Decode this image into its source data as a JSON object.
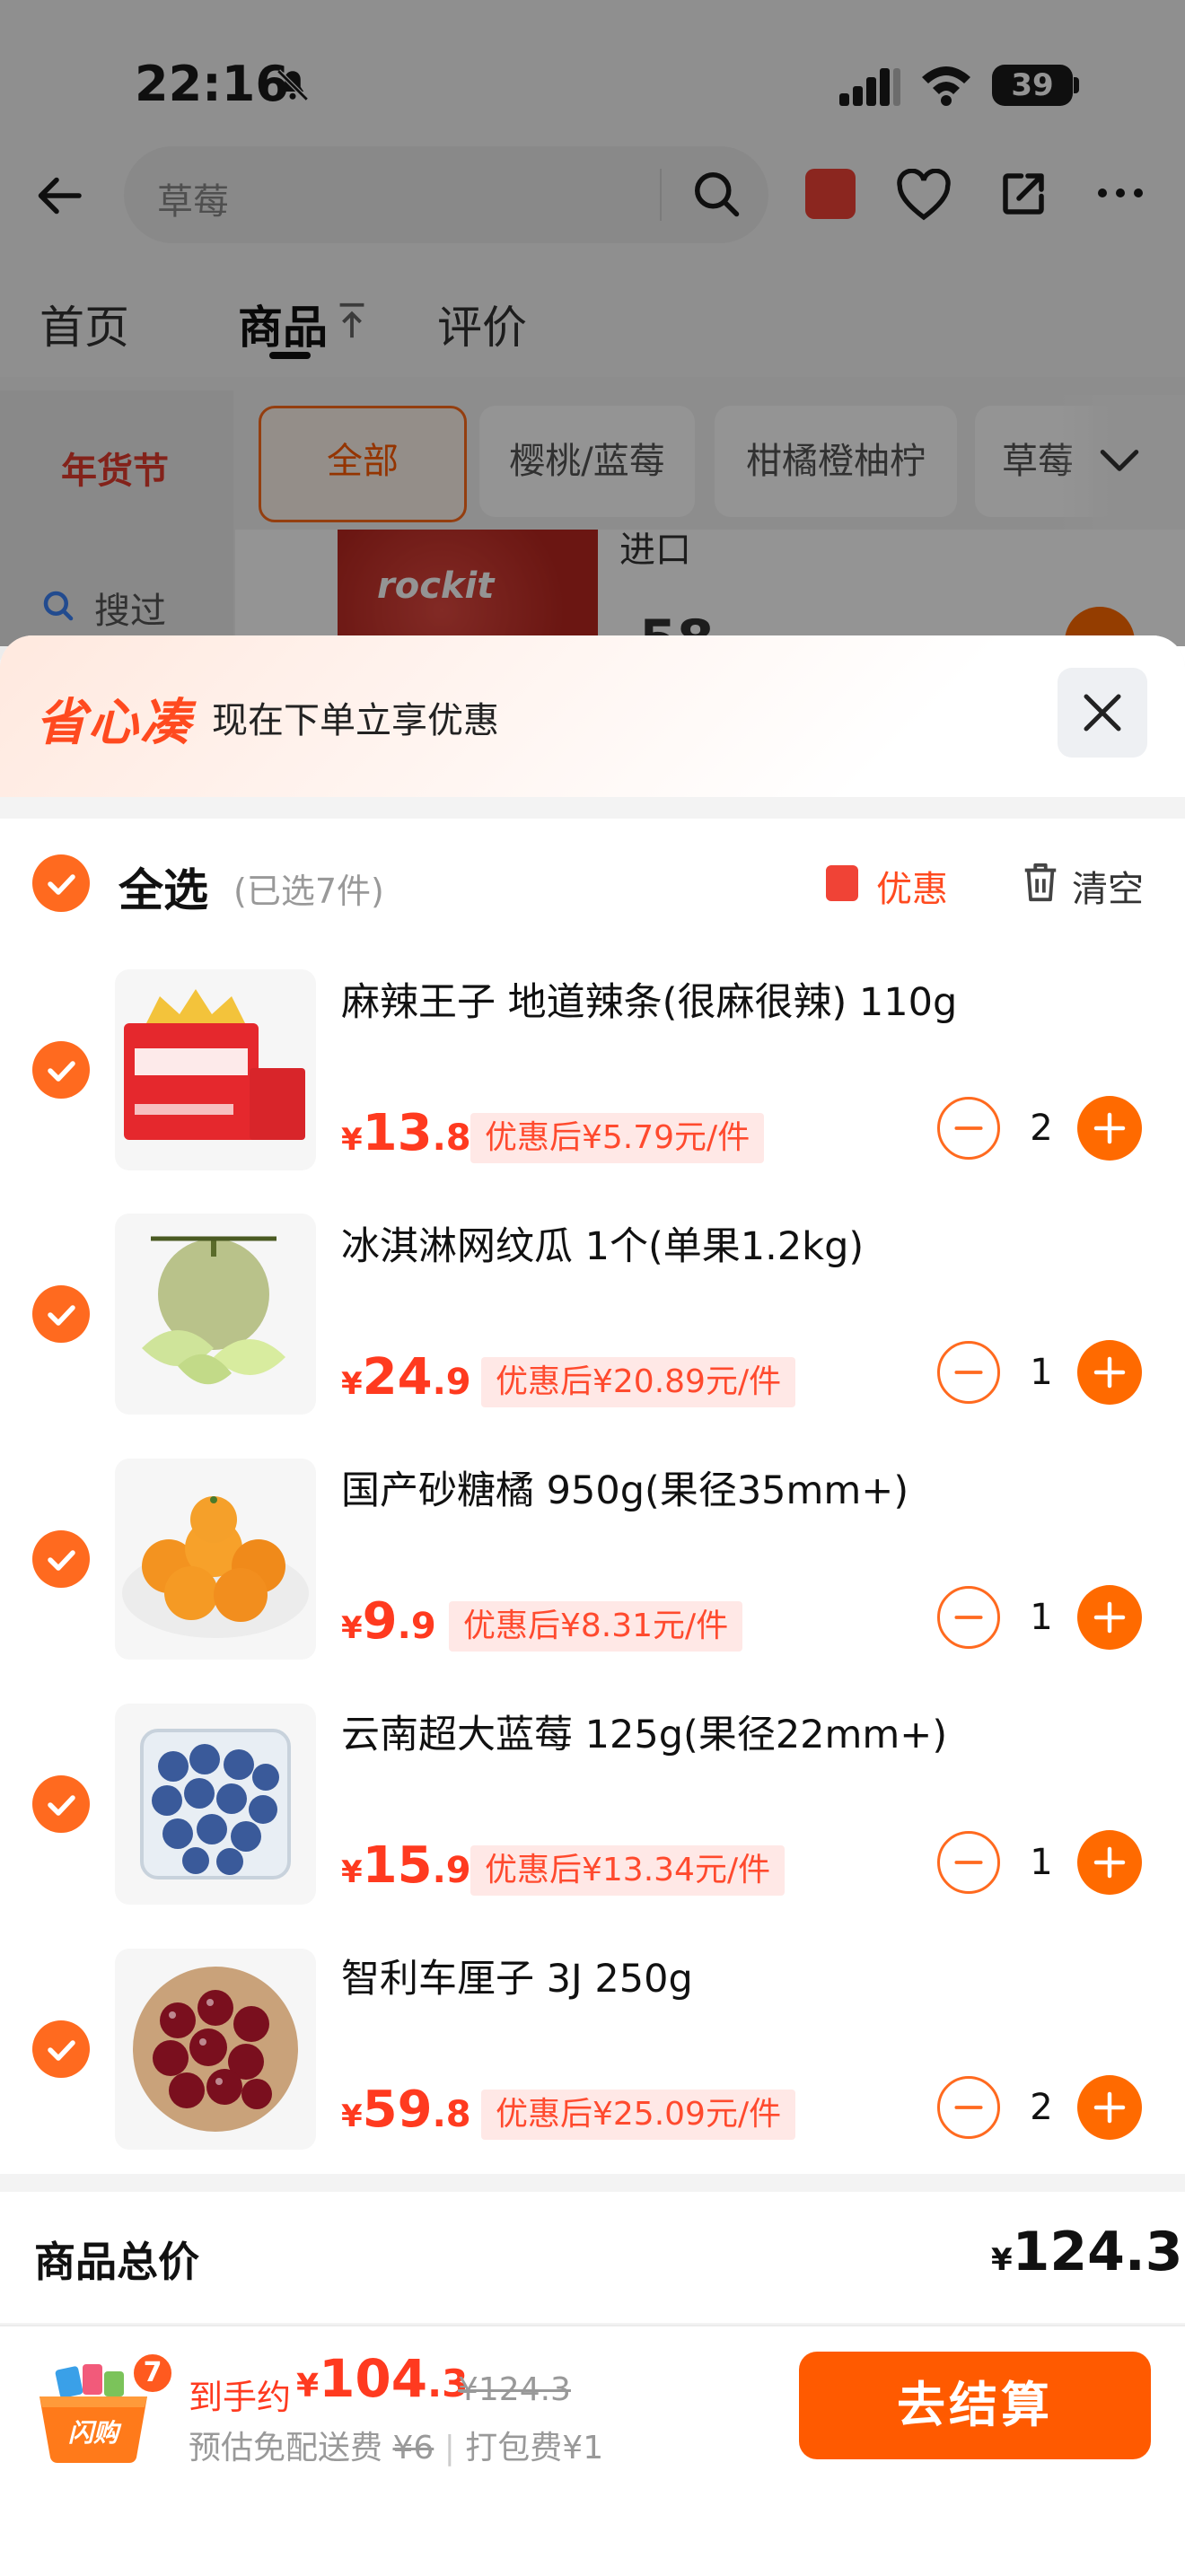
{
  "status_bar": {
    "time": "22:16",
    "battery": "39"
  },
  "search": {
    "query": "草莓"
  },
  "tabs": [
    {
      "label": "首页"
    },
    {
      "label": "商品"
    },
    {
      "label": "评价"
    }
  ],
  "left_nav": {
    "festival": "年货节",
    "history": "搜过"
  },
  "categories": [
    {
      "label": "全部"
    },
    {
      "label": "樱桃/蓝莓"
    },
    {
      "label": "柑橘橙柚柠"
    },
    {
      "label": "草莓"
    }
  ],
  "background_product": {
    "brand_text": "rockit",
    "title_fragment": "进口",
    "price_fragment": "58"
  },
  "sheet": {
    "brand": "省心凑",
    "promo": "现在下单立享优惠",
    "select_all": "全选",
    "selected_count": "(已选7件)",
    "coupon": "优惠",
    "clear": "清空"
  },
  "items": [
    {
      "title": "麻辣王子 地道辣条(很麻很辣) 110g",
      "price_int": "13",
      "price_dec": ".8",
      "discount": "优惠后¥5.79元/件",
      "qty": "2",
      "image": "spicy-strip-pack"
    },
    {
      "title": "冰淇淋网纹瓜 1个(单果1.2kg)",
      "price_int": "24",
      "price_dec": ".9",
      "discount": "优惠后¥20.89元/件",
      "qty": "1",
      "image": "melon"
    },
    {
      "title": "国产砂糖橘 950g(果径35mm+)",
      "price_int": "9",
      "price_dec": ".9",
      "discount": "优惠后¥8.31元/件",
      "qty": "1",
      "image": "mandarins"
    },
    {
      "title": "云南超大蓝莓 125g(果径22mm+)",
      "price_int": "15",
      "price_dec": ".9",
      "discount": "优惠后¥13.34元/件",
      "qty": "1",
      "image": "blueberries"
    },
    {
      "title": "智利车厘子 3J 250g",
      "price_int": "59",
      "price_dec": ".8",
      "discount": "优惠后¥25.09元/件",
      "qty": "2",
      "image": "cherries"
    }
  ],
  "total": {
    "label": "商品总价",
    "currency": "¥",
    "value": "124.3"
  },
  "footer": {
    "cart_label": "闪购",
    "cart_count": "7",
    "est_label": "到手约",
    "currency": "¥",
    "est_int": "104",
    "est_dec": ".3",
    "orig_price": "¥124.3",
    "delivery_prefix": "预估免配送费",
    "delivery_strike": "¥6",
    "packing": "打包费¥1",
    "checkout": "去结算"
  },
  "colors": {
    "accent": "#ff6a00",
    "price_red": "#ff3a1f",
    "discount_bg": "#ffe8e6"
  }
}
